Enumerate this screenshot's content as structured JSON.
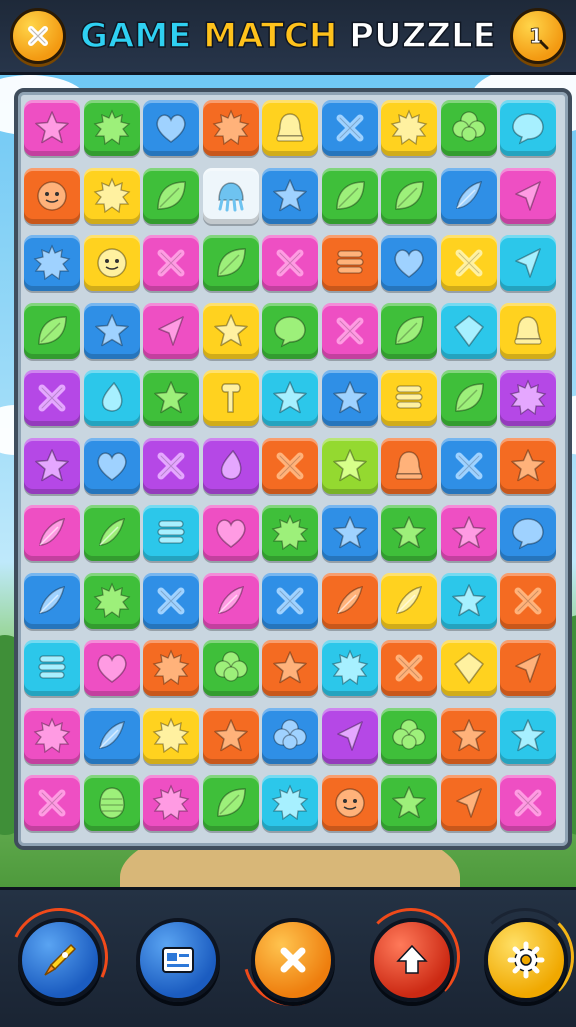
{
  "header": {
    "title_word1": "GAME",
    "title_word2": "MATCH",
    "title_word3": "PUZZLE",
    "left_button_icon": "close-x-icon",
    "right_button_icon": "level-one-icon",
    "right_button_text": "1"
  },
  "board": {
    "columns": 9,
    "rows": 11,
    "tiles": [
      [
        "pink:star",
        "green:sun",
        "blue:heart",
        "orange:sun",
        "yellow:bell",
        "blue:x",
        "yellow:sun",
        "green:clover",
        "cyan:speech"
      ],
      [
        "orange:face",
        "yellow:sun",
        "green:leaf",
        "white:jelly",
        "blue:star",
        "green:leaf",
        "green:leaf",
        "blue:feather",
        "pink:arrow"
      ],
      [
        "blue:sun",
        "yellow:face",
        "pink:x",
        "green:leaf",
        "pink:x",
        "orange:stack",
        "blue:heart",
        "yellow:x",
        "cyan:arrow"
      ],
      [
        "green:leaf",
        "blue:star",
        "pink:arrow",
        "yellow:star",
        "green:speech",
        "pink:x",
        "green:leaf",
        "cyan:diamond",
        "yellow:bell"
      ],
      [
        "purple:x",
        "cyan:drop",
        "green:star",
        "yellow:key",
        "cyan:star",
        "blue:star",
        "yellow:stack",
        "green:leaf",
        "purple:sun"
      ],
      [
        "purple:star",
        "blue:heart",
        "purple:x",
        "purple:drop",
        "orange:x",
        "lime:star",
        "orange:bell",
        "blue:x",
        "orange:star"
      ],
      [
        "pink:feather",
        "green:feather",
        "cyan:stack",
        "pink:heart",
        "green:sun",
        "blue:star",
        "green:star",
        "pink:star",
        "blue:speech"
      ],
      [
        "blue:feather",
        "green:sun",
        "blue:x",
        "pink:feather",
        "blue:x",
        "orange:feather",
        "yellow:feather",
        "cyan:star",
        "orange:x"
      ],
      [
        "cyan:stack",
        "pink:heart",
        "orange:sun",
        "green:clover",
        "orange:star",
        "cyan:sun",
        "orange:x",
        "yellow:diamond",
        "orange:arrow"
      ],
      [
        "pink:sun",
        "blue:feather",
        "yellow:sun",
        "orange:star",
        "blue:clover",
        "purple:arrow",
        "green:clover",
        "orange:star",
        "cyan:star"
      ],
      [
        "pink:x",
        "green:shell",
        "pink:sun",
        "green:leaf",
        "cyan:sun",
        "orange:face",
        "green:star",
        "orange:arrow",
        "pink:x"
      ]
    ]
  },
  "toolbar": {
    "buttons": [
      {
        "name": "rocket-boost-button",
        "icon": "rocket-icon",
        "color": "#2d78d8"
      },
      {
        "name": "card-button",
        "icon": "id-card-icon",
        "color": "#2d78d8"
      },
      {
        "name": "cancel-button",
        "icon": "close-x-icon",
        "color": "#f39a12"
      },
      {
        "name": "upgrade-button",
        "icon": "arrow-up-icon",
        "color": "#e84a2a"
      },
      {
        "name": "settings-button",
        "icon": "gear-icon",
        "color": "#f5b616"
      }
    ]
  },
  "colors": {
    "pink": "#ee4fc3",
    "green": "#3fbf3a",
    "blue": "#2f8fe6",
    "orange": "#f46b22",
    "yellow": "#ffd21f",
    "cyan": "#2cc7ea",
    "purple": "#b548e6",
    "lime": "#94d930",
    "white": "#eef6fb"
  }
}
